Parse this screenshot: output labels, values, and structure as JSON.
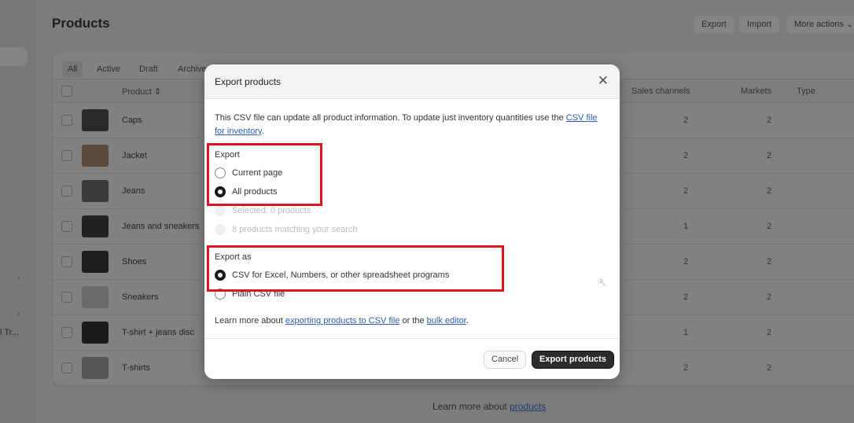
{
  "sidebar": {
    "truncated_item": "l Tr..."
  },
  "page": {
    "title": "Products",
    "actions": {
      "export": "Export",
      "import": "Import",
      "more": "More actions"
    }
  },
  "tabs": [
    "All",
    "Active",
    "Draft",
    "Archived"
  ],
  "table": {
    "columns": {
      "product": "Product",
      "sales_channels": "Sales channels",
      "markets": "Markets",
      "type": "Type"
    },
    "rows": [
      {
        "name": "Caps",
        "sales_channels": "2",
        "markets": "2"
      },
      {
        "name": "Jacket",
        "sales_channels": "2",
        "markets": "2"
      },
      {
        "name": "Jeans",
        "sales_channels": "2",
        "markets": "2"
      },
      {
        "name": "Jeans and sneakers",
        "sales_channels": "1",
        "markets": "2"
      },
      {
        "name": "Shoes",
        "sales_channels": "2",
        "markets": "2"
      },
      {
        "name": "Sneakers",
        "sales_channels": "2",
        "markets": "2"
      },
      {
        "name": "T-shirt + jeans disc",
        "sales_channels": "1",
        "markets": "2"
      },
      {
        "name": "T-shirts",
        "sales_channels": "2",
        "markets": "2"
      }
    ]
  },
  "footer": {
    "text": "Learn more about ",
    "link": "products"
  },
  "modal": {
    "title": "Export products",
    "desc": "This CSV file can update all product information. To update just inventory quantities use the ",
    "desc_link": "CSV file for inventory",
    "desc_end": ".",
    "export_label": "Export",
    "export_options": [
      {
        "label": "Current page",
        "selected": false,
        "disabled": false
      },
      {
        "label": "All products",
        "selected": true,
        "disabled": false
      },
      {
        "label": "Selected: 0 products",
        "selected": false,
        "disabled": true
      },
      {
        "label": "8 products matching your search",
        "selected": false,
        "disabled": true
      }
    ],
    "export_as_label": "Export as",
    "format_options": [
      {
        "label": "CSV for Excel, Numbers, or other spreadsheet programs",
        "selected": true
      },
      {
        "label": "Plain CSV file",
        "selected": false
      }
    ],
    "learn_prefix": "Learn more about ",
    "learn_link1": "exporting products to CSV file",
    "learn_mid": " or the ",
    "learn_link2": "bulk editor",
    "learn_end": ".",
    "cancel": "Cancel",
    "submit": "Export products"
  },
  "colors": {
    "highlight": "#e0141e",
    "primary": "#2c2c2c",
    "link": "#2a5db0"
  }
}
